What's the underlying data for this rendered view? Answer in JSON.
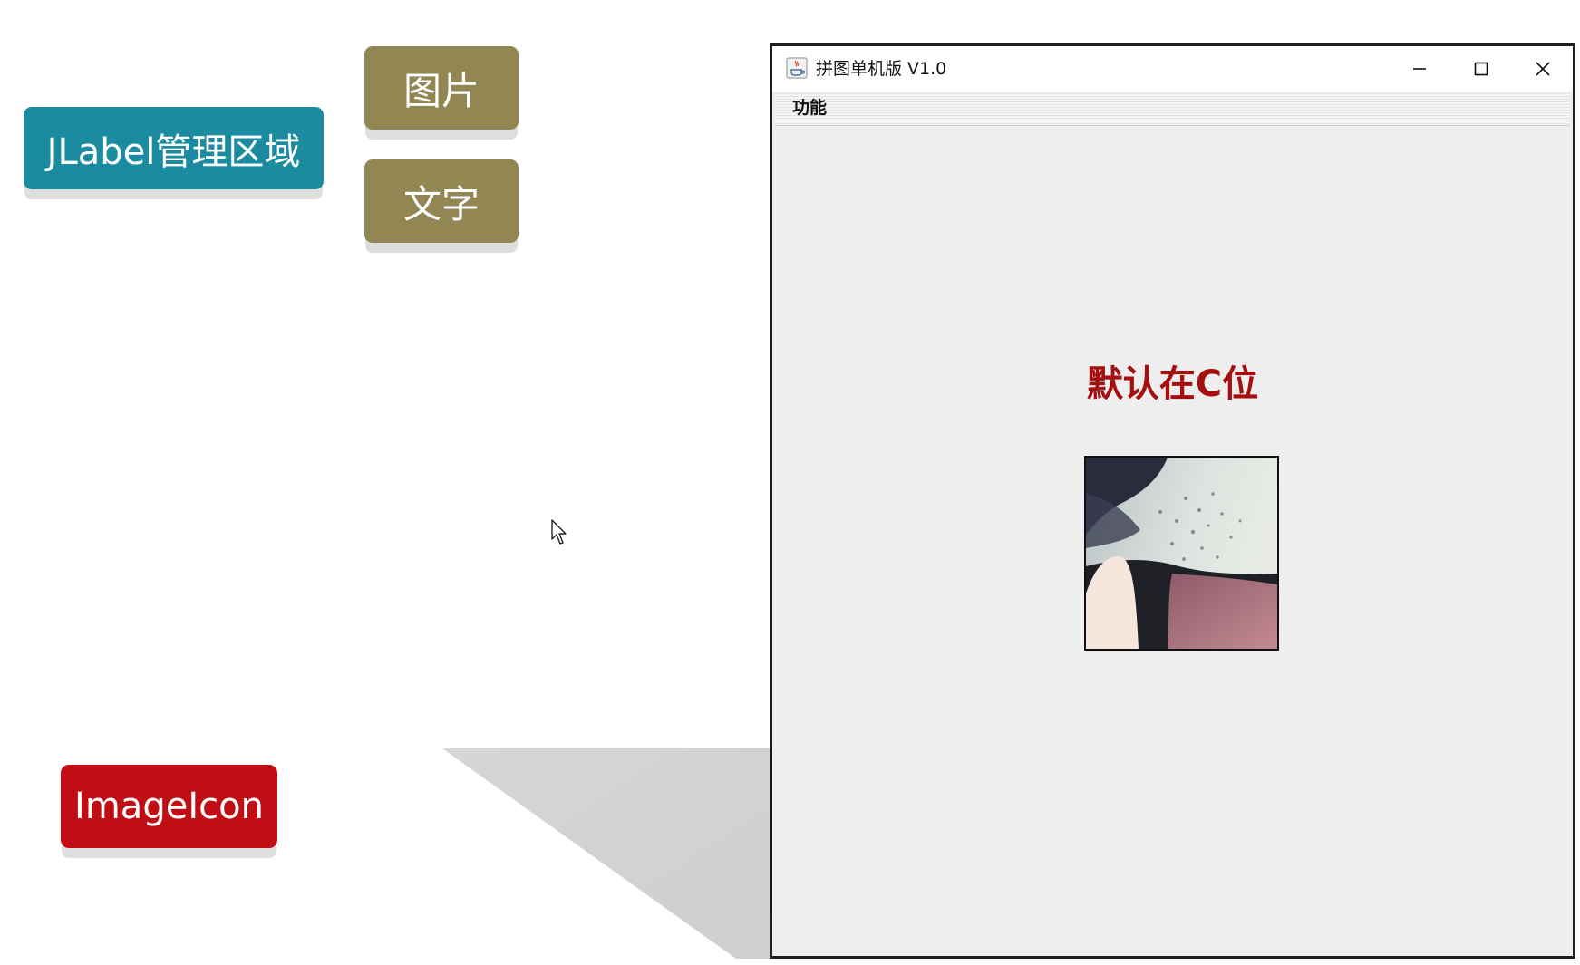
{
  "slide": {
    "jlabel_tag": "JLabel管理区域",
    "picture_tag": "图片",
    "text_tag": "文字",
    "imageicon_tag": "ImageIcon"
  },
  "window": {
    "title": "拼图单机版 V1.0",
    "menu": [
      "功能"
    ],
    "center_label": "默认在C位"
  },
  "icons": {
    "app": "java-cup-icon",
    "minimize": "minimize-icon",
    "maximize": "maximize-icon",
    "close": "close-icon",
    "cursor": "mouse-pointer-icon"
  },
  "colors": {
    "jlabel_tag": "#1b8ca0",
    "picture_tag": "#928752",
    "imageicon_tag": "#c10e15",
    "center_label": "#a50f10",
    "window_bg": "#eeeeee"
  }
}
